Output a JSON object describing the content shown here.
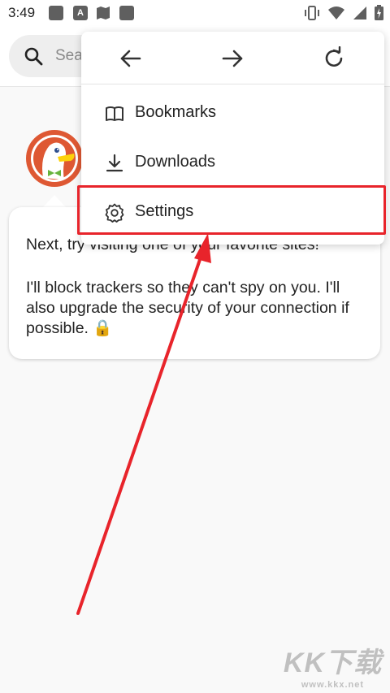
{
  "status_bar": {
    "time": "3:49",
    "notif_letter": "A"
  },
  "search": {
    "placeholder": "Search or type URL",
    "visible_text": "Sea"
  },
  "onboarding": {
    "line1": "Next, try visiting one of your favorite sites!",
    "line2": "I'll block trackers so they can't spy on you. I'll also upgrade the security of your connection if possible. 🔒"
  },
  "menu": {
    "nav": [
      "back-icon",
      "forward-icon",
      "refresh-icon"
    ],
    "items": [
      {
        "label": "Bookmarks",
        "icon": "book-icon"
      },
      {
        "label": "Downloads",
        "icon": "download-icon"
      },
      {
        "label": "Settings",
        "icon": "gear-icon"
      }
    ]
  },
  "annotation": {
    "highlight_color": "#e8242b",
    "highlighted_item": "Settings"
  },
  "watermark": {
    "logo": "KK下载",
    "url": "www.kkx.net"
  }
}
